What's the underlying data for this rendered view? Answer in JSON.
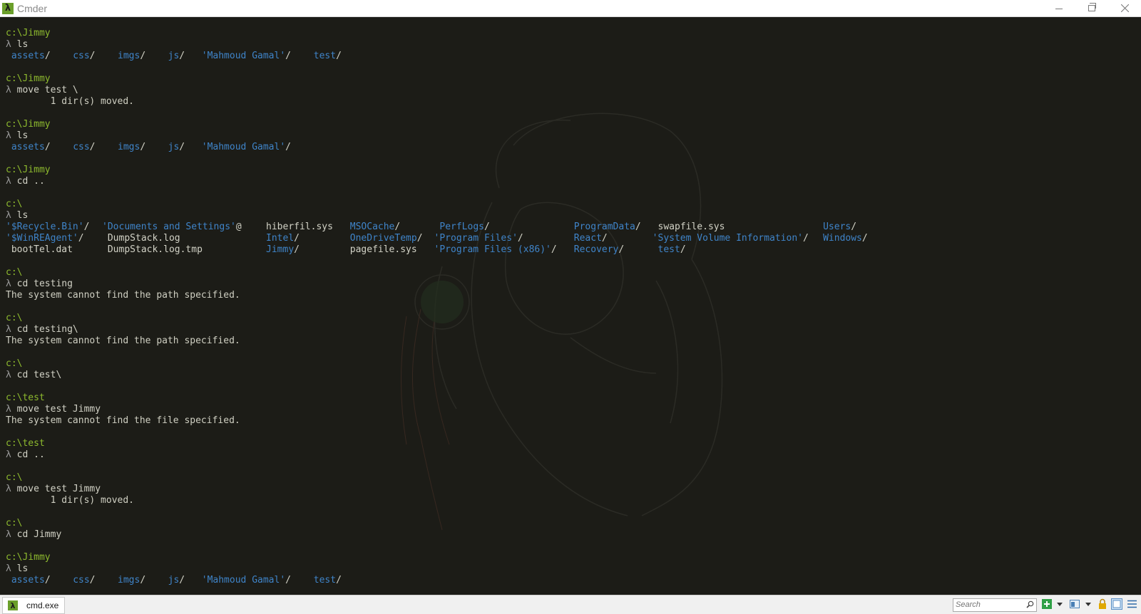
{
  "window": {
    "title": "Cmder",
    "app_icon": "λ",
    "buttons": [
      "minimize-icon",
      "restore-icon",
      "close-icon"
    ]
  },
  "prompt_symbol": "λ",
  "colors": {
    "path": "#8db92e",
    "directory": "#3f84c9",
    "text": "#d2d2c6",
    "background": "#1c1c17"
  },
  "terminal": {
    "lines": [
      {
        "t": "path",
        "text": "c:\\Jimmy"
      },
      {
        "t": "cmd",
        "text": "ls"
      },
      {
        "t": "ls",
        "items": [
          {
            "text": "assets",
            "suffix": "/",
            "dir": true
          },
          {
            "text": "css",
            "suffix": "/",
            "dir": true
          },
          {
            "text": "imgs",
            "suffix": "/",
            "dir": true
          },
          {
            "text": "js",
            "suffix": "/",
            "dir": true
          },
          {
            "text": "'Mahmoud Gamal'",
            "suffix": "/",
            "dir": true
          },
          {
            "text": "test",
            "suffix": "/",
            "dir": true
          }
        ]
      },
      {
        "t": "blank"
      },
      {
        "t": "path",
        "text": "c:\\Jimmy"
      },
      {
        "t": "cmd",
        "text": "move test \\"
      },
      {
        "t": "out",
        "text": "        1 dir(s) moved."
      },
      {
        "t": "blank"
      },
      {
        "t": "path",
        "text": "c:\\Jimmy"
      },
      {
        "t": "cmd",
        "text": "ls"
      },
      {
        "t": "ls",
        "items": [
          {
            "text": "assets",
            "suffix": "/",
            "dir": true
          },
          {
            "text": "css",
            "suffix": "/",
            "dir": true
          },
          {
            "text": "imgs",
            "suffix": "/",
            "dir": true
          },
          {
            "text": "js",
            "suffix": "/",
            "dir": true
          },
          {
            "text": "'Mahmoud Gamal'",
            "suffix": "/",
            "dir": true
          }
        ]
      },
      {
        "t": "blank"
      },
      {
        "t": "path",
        "text": "c:\\Jimmy"
      },
      {
        "t": "cmd",
        "text": "cd .."
      },
      {
        "t": "blank"
      },
      {
        "t": "path",
        "text": "c:\\"
      },
      {
        "t": "cmd",
        "text": "ls"
      },
      {
        "t": "ls",
        "items": [
          {
            "text": "'$Recycle.Bin'",
            "suffix": "/",
            "dir": true
          },
          {
            "text": "'Documents and Settings'",
            "suffix": "@",
            "dir": true
          },
          {
            "text": "hiberfil.sys",
            "suffix": "",
            "dir": false
          },
          {
            "text": "MSOCache",
            "suffix": "/",
            "dir": true
          },
          {
            "text": "PerfLogs",
            "suffix": "/",
            "dir": true
          },
          {
            "text": "ProgramData",
            "suffix": "/",
            "dir": true
          },
          {
            "text": "swapfile.sys",
            "suffix": "",
            "dir": false
          },
          {
            "text": "Users",
            "suffix": "/",
            "dir": true
          }
        ]
      },
      {
        "t": "ls",
        "items": [
          {
            "text": "'$WinREAgent'",
            "suffix": "/",
            "dir": true
          },
          {
            "text": "DumpStack.log",
            "suffix": "",
            "dir": false
          },
          {
            "text": "Intel",
            "suffix": "/",
            "dir": true
          },
          {
            "text": "OneDriveTemp",
            "suffix": "/",
            "dir": true
          },
          {
            "text": "'Program Files'",
            "suffix": "/",
            "dir": true
          },
          {
            "text": "React",
            "suffix": "/",
            "dir": true
          },
          {
            "text": "'System Volume Information'",
            "suffix": "/",
            "dir": true
          },
          {
            "text": "Windows",
            "suffix": "/",
            "dir": true
          }
        ]
      },
      {
        "t": "ls",
        "items": [
          {
            "text": "bootTel.dat",
            "suffix": "",
            "dir": false
          },
          {
            "text": "DumpStack.log.tmp",
            "suffix": "",
            "dir": false
          },
          {
            "text": "Jimmy",
            "suffix": "/",
            "dir": true
          },
          {
            "text": "pagefile.sys",
            "suffix": "",
            "dir": false
          },
          {
            "text": "'Program Files (x86)'",
            "suffix": "/",
            "dir": true
          },
          {
            "text": "Recovery",
            "suffix": "/",
            "dir": true
          },
          {
            "text": "test",
            "suffix": "/",
            "dir": true
          }
        ]
      },
      {
        "t": "blank"
      },
      {
        "t": "path",
        "text": "c:\\"
      },
      {
        "t": "cmd",
        "text": "cd testing"
      },
      {
        "t": "out",
        "text": "The system cannot find the path specified."
      },
      {
        "t": "blank"
      },
      {
        "t": "path",
        "text": "c:\\"
      },
      {
        "t": "cmd",
        "text": "cd testing\\"
      },
      {
        "t": "out",
        "text": "The system cannot find the path specified."
      },
      {
        "t": "blank"
      },
      {
        "t": "path",
        "text": "c:\\"
      },
      {
        "t": "cmd",
        "text": "cd test\\"
      },
      {
        "t": "blank"
      },
      {
        "t": "path",
        "text": "c:\\test"
      },
      {
        "t": "cmd",
        "text": "move test Jimmy"
      },
      {
        "t": "out",
        "text": "The system cannot find the file specified."
      },
      {
        "t": "blank"
      },
      {
        "t": "path",
        "text": "c:\\test"
      },
      {
        "t": "cmd",
        "text": "cd .."
      },
      {
        "t": "blank"
      },
      {
        "t": "path",
        "text": "c:\\"
      },
      {
        "t": "cmd",
        "text": "move test Jimmy"
      },
      {
        "t": "out",
        "text": "        1 dir(s) moved."
      },
      {
        "t": "blank"
      },
      {
        "t": "path",
        "text": "c:\\"
      },
      {
        "t": "cmd",
        "text": "cd Jimmy"
      },
      {
        "t": "blank"
      },
      {
        "t": "path",
        "text": "c:\\Jimmy"
      },
      {
        "t": "cmd",
        "text": "ls"
      },
      {
        "t": "ls",
        "items": [
          {
            "text": "assets",
            "suffix": "/",
            "dir": true
          },
          {
            "text": "css",
            "suffix": "/",
            "dir": true
          },
          {
            "text": "imgs",
            "suffix": "/",
            "dir": true
          },
          {
            "text": "js",
            "suffix": "/",
            "dir": true
          },
          {
            "text": "'Mahmoud Gamal'",
            "suffix": "/",
            "dir": true
          },
          {
            "text": "test",
            "suffix": "/",
            "dir": true
          }
        ]
      }
    ]
  },
  "statusbar": {
    "tab_label": "cmd.exe",
    "search_placeholder": "Search",
    "icons": [
      "search-icon",
      "new-console-icon",
      "dropdown-arrow-icon",
      "split-view-icon",
      "dropdown-arrow-icon",
      "lock-icon",
      "layout-icon",
      "menu-icon"
    ]
  }
}
